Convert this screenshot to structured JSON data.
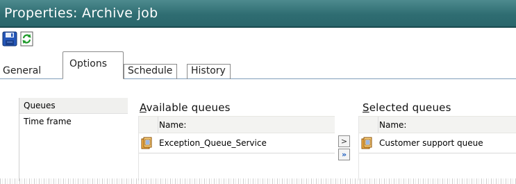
{
  "window": {
    "title": "Properties: Archive job",
    "title_bar_color": "#3a7a7e"
  },
  "toolbar": {
    "save_icon": "save-icon",
    "refresh_icon": "refresh-icon"
  },
  "tabs": [
    {
      "label": "General",
      "active": false
    },
    {
      "label": "Options",
      "active": true
    },
    {
      "label": "Schedule",
      "active": false
    },
    {
      "label": "History",
      "active": false
    }
  ],
  "options_nav": [
    {
      "label": "Queues",
      "active": true
    },
    {
      "label": "Time frame",
      "active": false
    }
  ],
  "available": {
    "title_prefix": "A",
    "title_rest": "vailable queues",
    "column_header": "Name:",
    "items": [
      "Exception_Queue_Service"
    ]
  },
  "selected": {
    "title_prefix": "S",
    "title_rest": "elected queues",
    "column_header": "Name:",
    "items": [
      "Customer support queue"
    ]
  },
  "move_buttons": {
    "add_one": ">",
    "add_all": "»"
  }
}
